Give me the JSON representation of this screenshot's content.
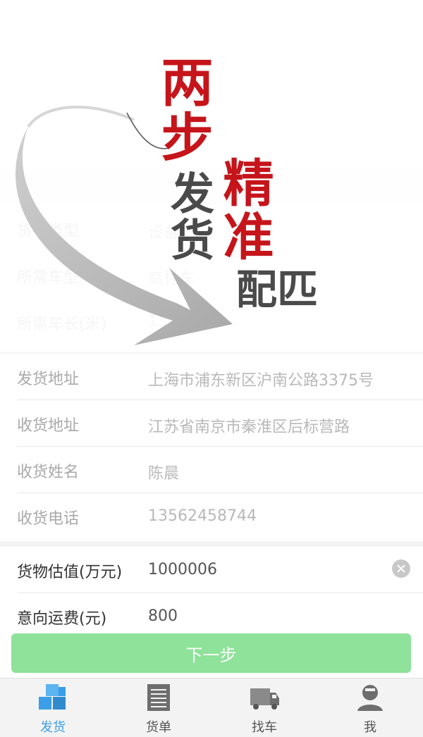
{
  "colors": {
    "accent_blue": "#3a9ee8",
    "slogan_red": "#c5151b",
    "button_green": "#8ee29a"
  },
  "cargo_info": {
    "rows": [
      {
        "label": "货物类型",
        "value": "设备"
      },
      {
        "label": "所需车型",
        "value": "高栏车"
      },
      {
        "label": "所需车长(米)",
        "value": "13"
      }
    ]
  },
  "address_info": {
    "rows": [
      {
        "label": "发货地址",
        "value": "上海市浦东新区沪南公路3375号"
      },
      {
        "label": "收货地址",
        "value": "江苏省南京市秦淮区后标营路"
      },
      {
        "label": "收货姓名",
        "value": "陈晨"
      },
      {
        "label": "收货电话",
        "value": "13562458744"
      }
    ]
  },
  "value_info": {
    "rows": [
      {
        "label": "货物估值(万元)",
        "value": "1000006"
      },
      {
        "label": "意向运费(元)",
        "value": "800"
      }
    ]
  },
  "overlay": {
    "line1": "两步",
    "line2": "发货",
    "line3": "精准",
    "line4": "匹配"
  },
  "next_button": {
    "label": "下一步"
  },
  "tabbar": {
    "items": [
      {
        "label": "发货",
        "icon": "cube-icon",
        "active": true
      },
      {
        "label": "货单",
        "icon": "list-document-icon",
        "active": false
      },
      {
        "label": "找车",
        "icon": "truck-icon",
        "active": false
      },
      {
        "label": "我",
        "icon": "user-icon",
        "active": false
      }
    ]
  }
}
